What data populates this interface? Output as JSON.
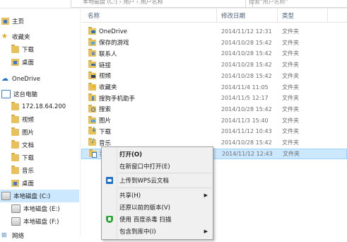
{
  "toolbar": {
    "address": "本地磁盘 (C:) › 用户 › 用户名称",
    "search_placeholder": "搜索\"用户名称\""
  },
  "nav": {
    "items": [
      {
        "label": "主页",
        "icon": "home-icon"
      },
      {
        "label": "收藏夹",
        "icon": "star-icon"
      },
      {
        "label": "下载",
        "icon": "downloads-folder-icon"
      },
      {
        "label": "桌面",
        "icon": "desktop-folder-icon"
      },
      {
        "label": "OneDrive",
        "icon": "onedrive-icon"
      },
      {
        "label": "这台电脑",
        "icon": "this-pc-icon"
      },
      {
        "label": "172.18.64.200",
        "icon": "network-folder-icon"
      },
      {
        "label": "视频",
        "icon": "videos-folder-icon"
      },
      {
        "label": "图片",
        "icon": "pictures-folder-icon"
      },
      {
        "label": "文档",
        "icon": "documents-folder-icon"
      },
      {
        "label": "下载",
        "icon": "downloads-folder-icon"
      },
      {
        "label": "音乐",
        "icon": "music-folder-icon"
      },
      {
        "label": "桌面",
        "icon": "desktop-folder-icon"
      },
      {
        "label": "本地磁盘 (C:)",
        "icon": "drive-icon",
        "selected": true
      },
      {
        "label": "本地磁盘 (E:)",
        "icon": "drive-icon"
      },
      {
        "label": "本地磁盘 (F:)",
        "icon": "drive-icon"
      },
      {
        "label": "网络",
        "icon": "network-icon"
      }
    ]
  },
  "columns": {
    "name": "名称",
    "date": "修改日期",
    "type": "类型"
  },
  "files": [
    {
      "name": "OneDrive",
      "date": "2014/11/12 12:31",
      "type": "文件夹",
      "icon": "fi-cloud"
    },
    {
      "name": "保存的游戏",
      "date": "2014/10/28 15:42",
      "type": "文件夹",
      "icon": "fi-game"
    },
    {
      "name": "联系人",
      "date": "2014/10/28 15:42",
      "type": "文件夹",
      "icon": "fi-contact"
    },
    {
      "name": "链接",
      "date": "2014/10/28 15:42",
      "type": "文件夹",
      "icon": "fi-link"
    },
    {
      "name": "视频",
      "date": "2014/10/28 15:42",
      "type": "文件夹",
      "icon": "fi-video"
    },
    {
      "name": "收藏夹",
      "date": "2014/11/4 11:05",
      "type": "文件夹",
      "icon": "fi-star"
    },
    {
      "name": "搜狗手机助手",
      "date": "2014/11/5 12:17",
      "type": "文件夹",
      "icon": "fi-phone"
    },
    {
      "name": "搜索",
      "date": "2014/10/28 15:42",
      "type": "文件夹",
      "icon": "fi-search"
    },
    {
      "name": "图片",
      "date": "2014/11/3 15:40",
      "type": "文件夹",
      "icon": "fi-pic"
    },
    {
      "name": "下载",
      "date": "2014/11/12 10:43",
      "type": "文件夹",
      "icon": "fi-down"
    },
    {
      "name": "音乐",
      "date": "2014/10/28 15:42",
      "type": "文件夹",
      "icon": "fi-music"
    },
    {
      "name": "我",
      "date": "2014/11/12 12:43",
      "type": "文件夹",
      "icon": "fi-doc",
      "selected": true
    }
  ],
  "menu": {
    "open": "打开(O)",
    "open_new_window": "在新窗口中打开(E)",
    "upload_wps": "上传到WPS云文档",
    "share": "共享(H)",
    "restore": "还原以前的版本(V)",
    "scan": "使用 百度杀毒 扫描",
    "include_library": "包含到库中(I)"
  }
}
